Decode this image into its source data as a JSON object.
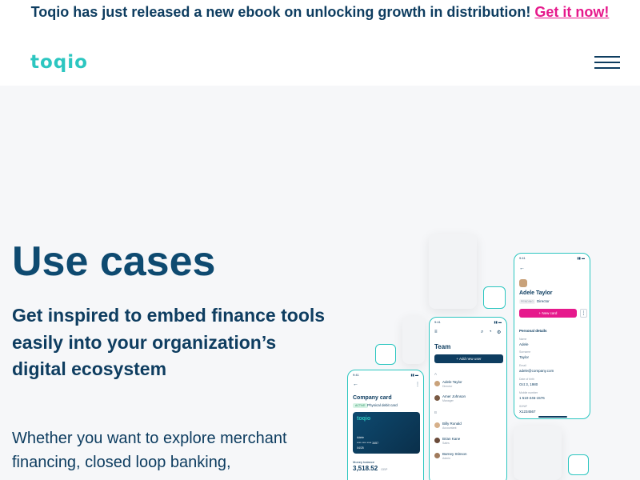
{
  "banner": {
    "text": "Toqio has just released a new ebook on unlocking growth in distribution!",
    "link_label": "Get it now!"
  },
  "header": {
    "logo": "toqio",
    "menu_icon": "hamburger-icon"
  },
  "hero": {
    "title": "Use cases",
    "subtitle": "Get inspired to embed finance tools easily into your organization’s digital ecosystem",
    "body": "Whether you want to explore merchant financing, closed loop banking,"
  },
  "phone_left": {
    "time": "9:41",
    "title": "Company card",
    "badge": "ACTIVE",
    "card_type": "Physical debit card",
    "card_logo": "toqio",
    "card_holder": "Adele",
    "card_number": "**** **** **** 3457",
    "card_expiry": "04/25",
    "balance_label": "Money balance",
    "balance": "3,518.52",
    "currency": "GBP"
  },
  "phone_middle": {
    "time": "9:41",
    "title": "Team",
    "add_button": "+ Add new user",
    "section_a": "A",
    "section_b": "B",
    "members_a": [
      {
        "name": "Adele Taylor",
        "role": "Director"
      },
      {
        "name": "Amer Johnson",
        "role": "Manager"
      }
    ],
    "members_b": [
      {
        "name": "Billy Ronald",
        "role": "Accountant"
      },
      {
        "name": "Brian Kane",
        "role": "Sales"
      },
      {
        "name": "Barney Stinson",
        "role": "Admin"
      }
    ]
  },
  "phone_right": {
    "time": "9:41",
    "name": "Adele Taylor",
    "badge": "PENDING",
    "role": "Director",
    "new_card_button": "+ New card",
    "section": "Personal details",
    "fields": [
      {
        "label": "Name",
        "value": "Adele"
      },
      {
        "label": "Surname",
        "value": "Taylor"
      },
      {
        "label": "Email",
        "value": "adele@company.com"
      },
      {
        "label": "Date of birth",
        "value": "Oct 3, 1980"
      },
      {
        "label": "Mobile number",
        "value": "1 510-246-1576"
      },
      {
        "label": "ID/NIF",
        "value": "X1234567"
      }
    ]
  },
  "colors": {
    "navy": "#0e3d60",
    "teal": "#2cc6c0",
    "pink": "#e6198c",
    "background": "#f6f7f9"
  }
}
